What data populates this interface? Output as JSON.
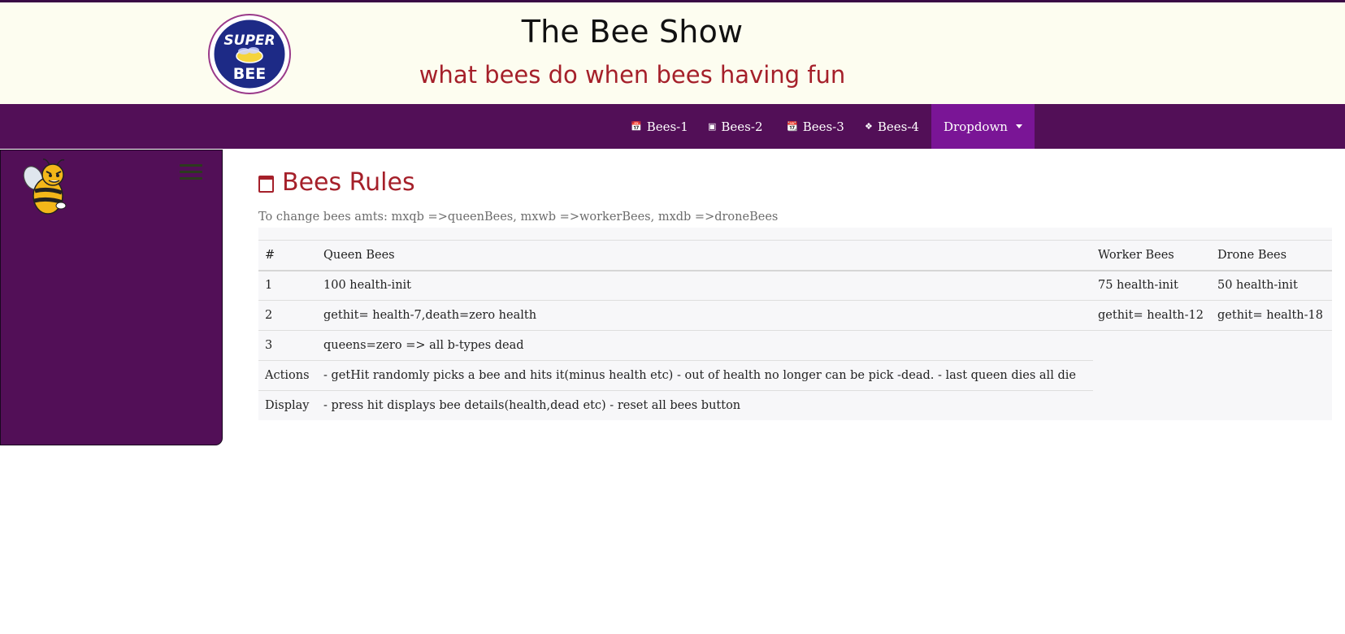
{
  "header": {
    "logo_text_top": "SUPER",
    "logo_text_bottom": "BEE",
    "title": "The Bee Show",
    "subtitle": "what bees do when bees having fun"
  },
  "nav": {
    "items": [
      {
        "icon": "calendar-icon",
        "label": "Bees-1"
      },
      {
        "icon": "image-icon",
        "label": "Bees-2"
      },
      {
        "icon": "calendar-check-icon",
        "label": "Bees-3"
      },
      {
        "icon": "tag-icon",
        "label": "Bees-4"
      }
    ],
    "dropdown_label": "Dropdown"
  },
  "main": {
    "title": "Bees Rules",
    "hint": "To change bees amts: mxqb =>queenBees, mxwb =>workerBees, mxdb =>droneBees",
    "table": {
      "headers": [
        "#",
        "Queen Bees",
        "Worker Bees",
        "Drone Bees"
      ],
      "rows": [
        [
          "1",
          "100 health-init",
          "75 health-init",
          "50 health-init"
        ],
        [
          "2",
          "gethit= health-7,death=zero health",
          "gethit= health-12",
          "gethit= health-18"
        ],
        [
          "3",
          "queens=zero => all b-types dead",
          "",
          ""
        ],
        [
          "Actions",
          "- getHit randomly picks a bee and hits it(minus health etc) - out of health no longer can be pick -dead. - last queen dies all die",
          "",
          ""
        ],
        [
          "Display",
          "- press hit displays bee details(health,dead etc) - reset all bees button",
          "",
          ""
        ]
      ]
    }
  },
  "colors": {
    "header_bg": "#fdfdf0",
    "nav_bg": "#520f57",
    "nav_active_bg": "#7a1596",
    "accent_red": "#a5202a",
    "table_bg": "#f7f7f9"
  }
}
